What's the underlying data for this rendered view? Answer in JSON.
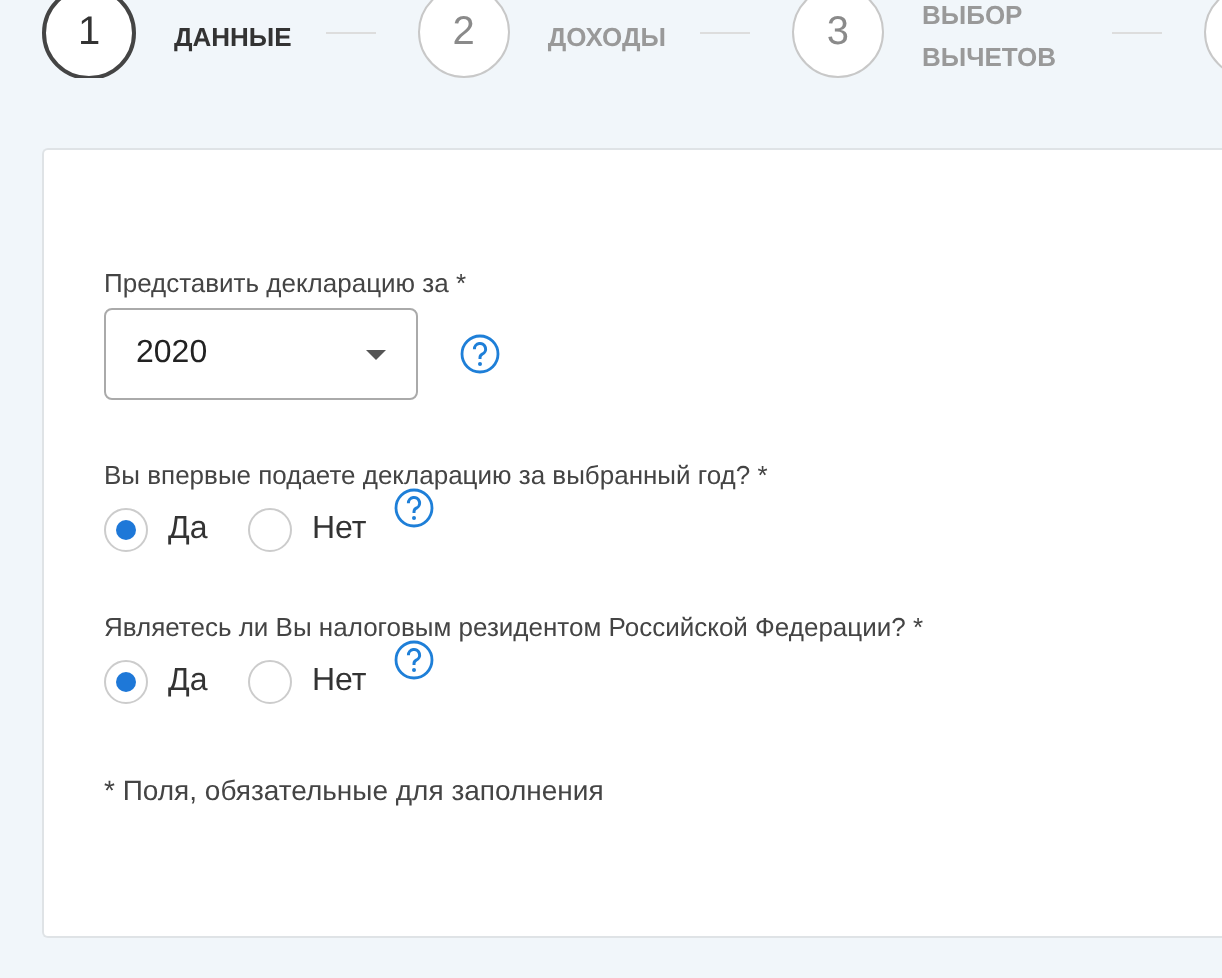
{
  "steps": [
    {
      "number": "1",
      "label": "ДАННЫЕ",
      "selected": true
    },
    {
      "number": "2",
      "label": "ДОХОДЫ",
      "selected": false
    },
    {
      "number": "3",
      "label": "ВЫБОР ВЫЧЕТОВ",
      "selected": false
    }
  ],
  "form": {
    "fields": [
      {
        "kind": "select",
        "label": "Представить декларацию за *",
        "value": "2020",
        "help": true
      },
      {
        "kind": "radio",
        "label": "Вы впервые подаете декларацию за выбранный год? *",
        "options": [
          {
            "label": "Да",
            "selected": true
          },
          {
            "label": "Нет",
            "selected": false
          }
        ],
        "help": true
      },
      {
        "kind": "radio",
        "label": "Являетесь ли Вы налоговым резидентом Российской Федерации? *",
        "options": [
          {
            "label": "Да",
            "selected": true
          },
          {
            "label": "Нет",
            "selected": false
          }
        ],
        "help": true
      }
    ],
    "footnote": "* Поля, обязательные для заполнения"
  }
}
